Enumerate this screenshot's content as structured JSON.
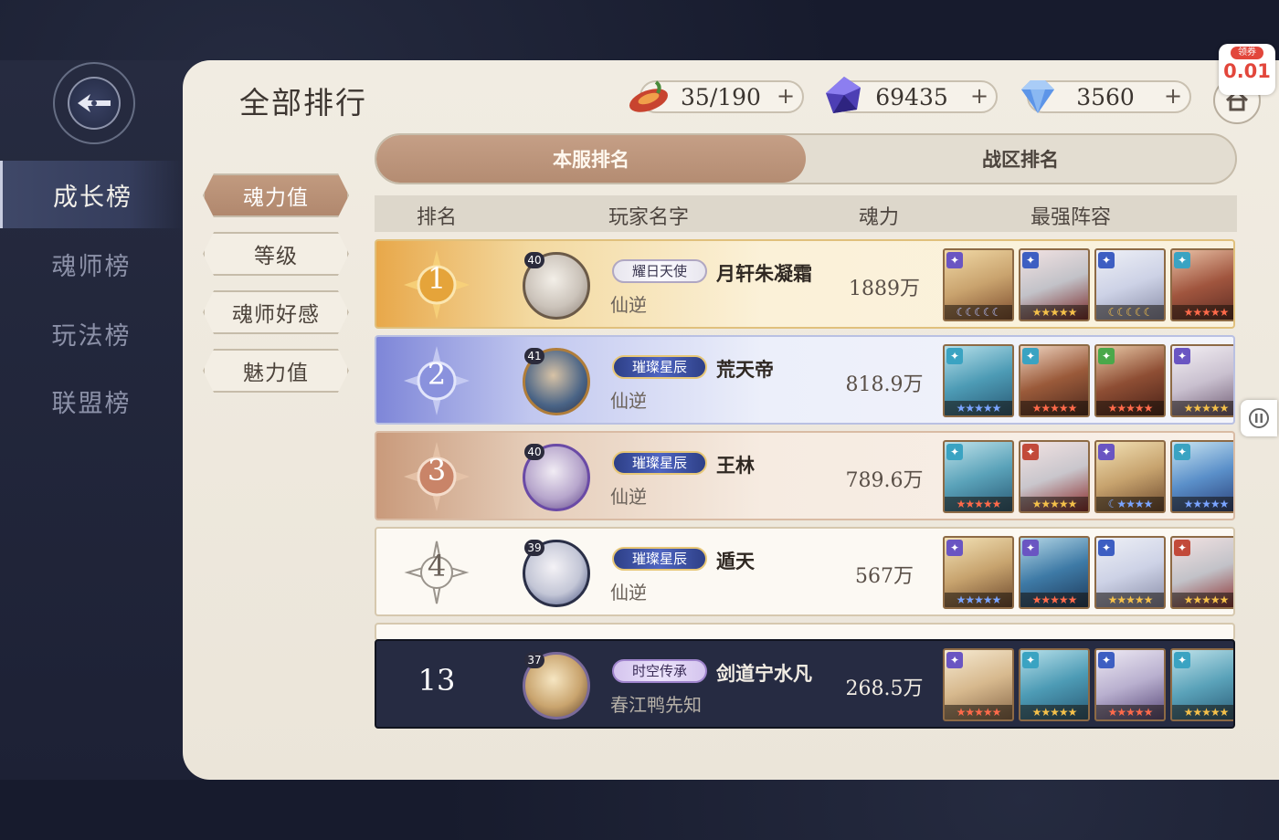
{
  "page_title": "全部排行",
  "side_nav": [
    {
      "label": "成长榜",
      "active": true
    },
    {
      "label": "魂师榜",
      "active": false
    },
    {
      "label": "玩法榜",
      "active": false
    },
    {
      "label": "联盟榜",
      "active": false
    }
  ],
  "resources": [
    {
      "icon": "stamina-icon",
      "value": "35/190",
      "plus": "+"
    },
    {
      "icon": "purple-crystal-icon",
      "value": "69435",
      "plus": "+"
    },
    {
      "icon": "diamond-icon",
      "value": "3560",
      "plus": "+"
    }
  ],
  "coupon": {
    "label": "领券",
    "value": "0.01"
  },
  "tabs": [
    {
      "label": "本服排名",
      "active": true
    },
    {
      "label": "战区排名",
      "active": false
    }
  ],
  "categories": [
    {
      "label": "魂力值",
      "active": true
    },
    {
      "label": "等级",
      "active": false
    },
    {
      "label": "魂师好感",
      "active": false
    },
    {
      "label": "魅力值",
      "active": false
    }
  ],
  "table_headers": {
    "rank": "排名",
    "player_name": "玩家名字",
    "power": "魂力",
    "lineup": "最强阵容"
  },
  "rows": [
    {
      "rank": "1",
      "level": "40",
      "title": "耀日天使",
      "name": "月轩朱凝霜",
      "server": "仙逆",
      "power": "1889万"
    },
    {
      "rank": "2",
      "level": "41",
      "title": "璀璨星辰",
      "name": "荒天帝",
      "server": "仙逆",
      "power": "818.9万"
    },
    {
      "rank": "3",
      "level": "40",
      "title": "璀璨星辰",
      "name": "王林",
      "server": "仙逆",
      "power": "789.6万"
    },
    {
      "rank": "4",
      "level": "39",
      "title": "璀璨星辰",
      "name": "遁天",
      "server": "仙逆",
      "power": "567万"
    }
  ],
  "self_row": {
    "rank": "13",
    "level": "37",
    "title": "时空传承",
    "name": "剑道宁水凡",
    "server": "春江鸭先知",
    "power": "268.5万"
  },
  "colors": {
    "rank1": "#e8a84a",
    "rank2": "#7e86d8",
    "rank3": "#c99a7b",
    "accent_tab": "#b48c72",
    "self_row_bg": "#262b42"
  }
}
